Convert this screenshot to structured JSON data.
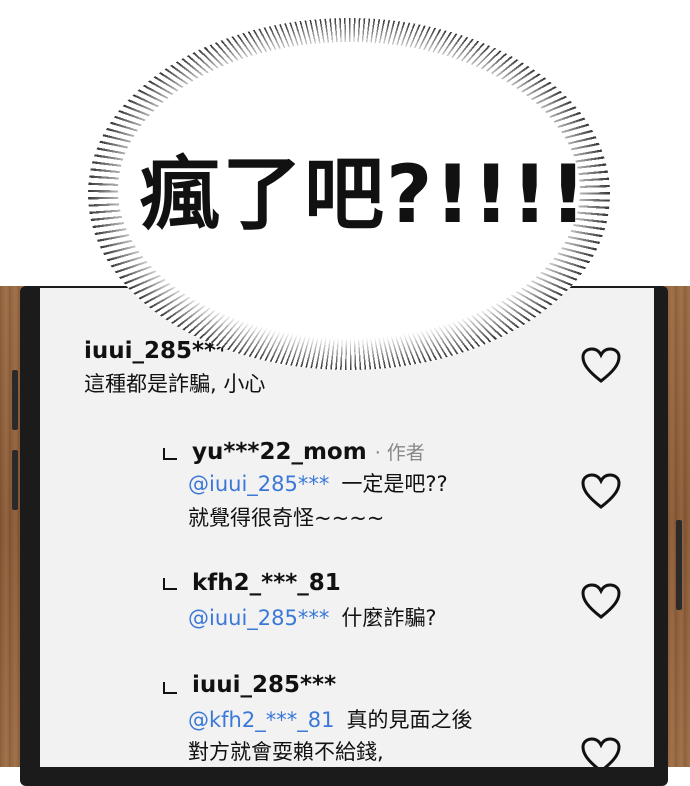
{
  "speech_bubble": {
    "text": "瘋了吧?!!!!"
  },
  "comments": [
    {
      "username": "iuui_285***",
      "author_tag": "",
      "is_reply": false,
      "mention": "",
      "lines": [
        "這種都是詐騙, 小心"
      ]
    },
    {
      "username": "yu***22_mom",
      "author_tag": "· 作者",
      "is_reply": true,
      "mention": "@iuui_285***",
      "lines": [
        "一定是吧??",
        "就覺得很奇怪~~~~"
      ]
    },
    {
      "username": "kfh2_***_81",
      "author_tag": "",
      "is_reply": true,
      "mention": "@iuui_285***",
      "lines": [
        "什麼詐騙?"
      ]
    },
    {
      "username": "iuui_285***",
      "author_tag": "",
      "is_reply": true,
      "mention": "@kfh2_***_81",
      "lines": [
        "真的見面之後",
        "對方就會耍賴不給錢,"
      ]
    }
  ],
  "icons": {
    "like": "heart-outline-icon",
    "reply": "reply-arrow-icon"
  },
  "colors": {
    "mention": "#3a78d8",
    "screen": "#f2f2f2",
    "wood": "#8a5a36"
  }
}
